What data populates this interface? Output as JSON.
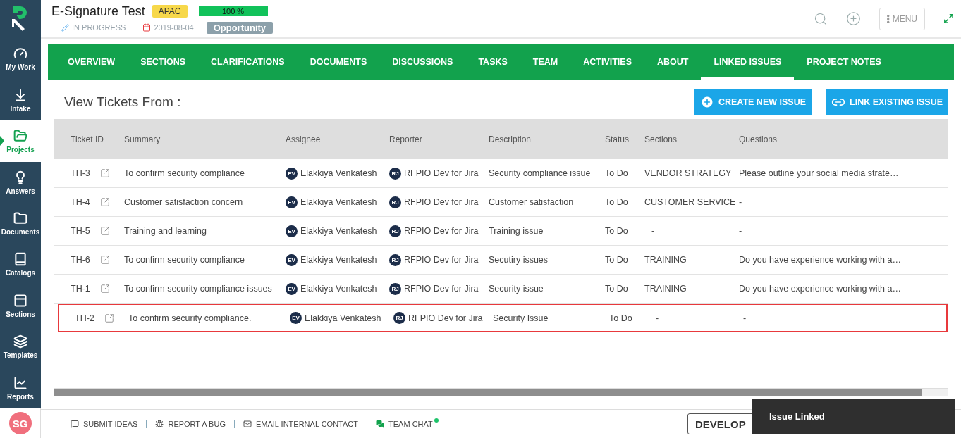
{
  "project": {
    "title": "E-Signature Test",
    "region": "APAC",
    "progress": {
      "level": 1,
      "label": "100 %"
    },
    "status": "IN PROGRESS",
    "date": "2019-08-04",
    "type": "Opportunity"
  },
  "header_actions": {
    "menu": "MENU"
  },
  "sidebar": {
    "items": [
      {
        "label": "My Work",
        "selected": false
      },
      {
        "label": "Intake",
        "selected": false
      },
      {
        "label": "Projects",
        "selected": true
      },
      {
        "label": "Answers",
        "selected": false
      },
      {
        "label": "Documents",
        "selected": false
      },
      {
        "label": "Catalogs",
        "selected": false
      },
      {
        "label": "Sections",
        "selected": false
      },
      {
        "label": "Templates",
        "selected": false
      },
      {
        "label": "Reports",
        "selected": false
      }
    ],
    "user_initials": "SG"
  },
  "tabs": [
    {
      "label": "OVERVIEW",
      "selected": false
    },
    {
      "label": "SECTIONS",
      "selected": false
    },
    {
      "label": "CLARIFICATIONS",
      "selected": false
    },
    {
      "label": "DOCUMENTS",
      "selected": false
    },
    {
      "label": "DISCUSSIONS",
      "selected": false
    },
    {
      "label": "TASKS",
      "selected": false
    },
    {
      "label": "TEAM",
      "selected": false
    },
    {
      "label": "ACTIVITIES",
      "selected": false
    },
    {
      "label": "ABOUT",
      "selected": false
    },
    {
      "label": "LINKED ISSUES",
      "selected": true
    },
    {
      "label": "PROJECT NOTES",
      "selected": false
    }
  ],
  "view_label": "View Tickets From :",
  "buttons": {
    "create": "CREATE NEW ISSUE",
    "link": "LINK EXISTING ISSUE"
  },
  "table": {
    "columns": [
      "Ticket ID",
      "Summary",
      "Assignee",
      "Reporter",
      "Description",
      "Status",
      "Sections",
      "Questions"
    ],
    "rows": [
      {
        "id": "TH-3",
        "summary": "To confirm security compliance",
        "assignee": {
          "initials": "EV",
          "name": "Elakkiya Venkatesh"
        },
        "reporter": {
          "initials": "RJ",
          "name": "RFPIO Dev for Jira"
        },
        "description": "Security compliance issue",
        "status": "To Do",
        "sections": "VENDOR STRATEGY",
        "questions": "Please outline your social media strate…",
        "selected": false
      },
      {
        "id": "TH-4",
        "summary": "Customer satisfaction concern",
        "assignee": {
          "initials": "EV",
          "name": "Elakkiya Venkatesh"
        },
        "reporter": {
          "initials": "RJ",
          "name": "RFPIO Dev for Jira"
        },
        "description": "Customer satisfaction",
        "status": "To Do",
        "sections": "CUSTOMER SERVICE",
        "questions": "-",
        "selected": false
      },
      {
        "id": "TH-5",
        "summary": "Training and learning",
        "assignee": {
          "initials": "EV",
          "name": "Elakkiya Venkatesh"
        },
        "reporter": {
          "initials": "RJ",
          "name": "RFPIO Dev for Jira"
        },
        "description": "Training issue",
        "status": "To Do",
        "sections": "-",
        "questions": "-",
        "selected": false
      },
      {
        "id": "TH-6",
        "summary": "To confirm security compliance",
        "assignee": {
          "initials": "EV",
          "name": "Elakkiya Venkatesh"
        },
        "reporter": {
          "initials": "RJ",
          "name": "RFPIO Dev for Jira"
        },
        "description": "Secutiry issues",
        "status": "To Do",
        "sections": "TRAINING",
        "questions": "Do you have experience working with a…",
        "selected": false
      },
      {
        "id": "TH-1",
        "summary": "To confirm security compliance issues",
        "assignee": {
          "initials": "EV",
          "name": "Elakkiya Venkatesh"
        },
        "reporter": {
          "initials": "RJ",
          "name": "RFPIO Dev for Jira"
        },
        "description": "Security issue",
        "status": "To Do",
        "sections": "TRAINING",
        "questions": "Do you have experience working with a…",
        "selected": false
      },
      {
        "id": "TH-2",
        "summary": "To confirm security compliance.",
        "assignee": {
          "initials": "EV",
          "name": "Elakkiya Venkatesh"
        },
        "reporter": {
          "initials": "RJ",
          "name": "RFPIO Dev for Jira"
        },
        "description": "Security Issue",
        "status": "To Do",
        "sections": "-",
        "questions": "-",
        "selected": true
      }
    ]
  },
  "footer": {
    "links": [
      "SUBMIT IDEAS",
      "REPORT A BUG",
      "EMAIL INTERNAL CONTACT",
      "TEAM CHAT"
    ],
    "team_chat_online": true,
    "env_button": "DEVELOP"
  },
  "toast": "Issue Linked"
}
